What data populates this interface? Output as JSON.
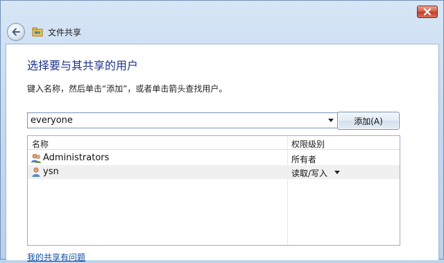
{
  "window": {
    "title": "文件共享",
    "close_icon": "close-icon",
    "back_icon": "back-arrow-icon",
    "app_icon": "file-sharing-icon"
  },
  "main": {
    "heading": "选择要与其共享的用户",
    "instruction": "键入名称，然后单击“添加”，或者单击箭头查找用户。",
    "name_input": {
      "value": "everyone"
    },
    "add_button_label": "添加(A)",
    "table": {
      "columns": [
        "名称",
        "权限级别"
      ],
      "rows": [
        {
          "name": "Administrators",
          "permission": "所有者",
          "icon": "user-group-icon"
        },
        {
          "name": "ysn",
          "permission": "读取/写入",
          "icon": "user-icon",
          "has_dropdown": true
        }
      ]
    },
    "help_link": "我的共享有问题"
  }
}
